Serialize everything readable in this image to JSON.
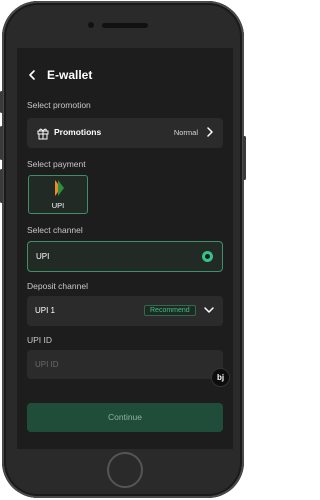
{
  "header": {
    "title": "E-wallet",
    "back_icon": "chevron-left-icon"
  },
  "promotion": {
    "section_label": "Select promotion",
    "label": "Promotions",
    "value": "Normal",
    "icon": "gift-icon"
  },
  "payment": {
    "section_label": "Select payment",
    "options": [
      {
        "label": "UPI",
        "selected": true,
        "icon": "upi-logo-icon"
      }
    ]
  },
  "channel": {
    "section_label": "Select channel",
    "value": "UPI",
    "selected": true
  },
  "deposit": {
    "section_label": "Deposit channel",
    "value": "UPI 1",
    "badge": "Recommend"
  },
  "upi_id": {
    "section_label": "UPI ID",
    "placeholder": "UPI ID"
  },
  "brand_badge": "bj",
  "continue_label": "Continue",
  "colors": {
    "accent": "#35c387",
    "background": "#1c1d1c",
    "card": "#2a2b2a",
    "button": "#1f4d3a"
  }
}
